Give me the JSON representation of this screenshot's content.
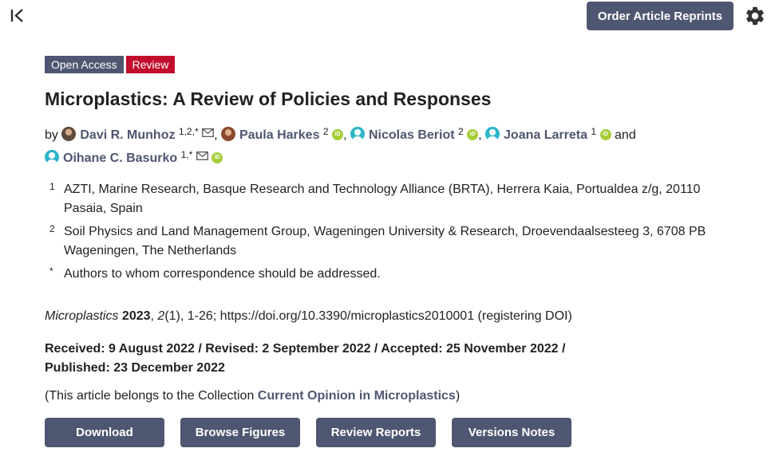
{
  "header": {
    "reprints_label": "Order Article Reprints"
  },
  "icons": {
    "collapse": "collapse-left-icon",
    "settings": "gear-icon",
    "email": "envelope-icon",
    "orcid": "orcid-icon",
    "avatar": "user-avatar-icon"
  },
  "badges": {
    "open_access": "Open Access",
    "type": "Review"
  },
  "article": {
    "title": "Microplastics: A Review of Policies and Responses",
    "by_label": "by",
    "and_label": "and",
    "authors": [
      {
        "name": "Davi R. Munhoz",
        "sup": "1,2,*"
      },
      {
        "name": "Paula Harkes",
        "sup": "2"
      },
      {
        "name": "Nicolas Beriot",
        "sup": "2"
      },
      {
        "name": "Joana Larreta",
        "sup": "1"
      },
      {
        "name": "Oihane C. Basurko",
        "sup": "1,*"
      }
    ],
    "affiliations": [
      {
        "marker": "1",
        "text": "AZTI, Marine Research, Basque Research and Technology Alliance (BRTA), Herrera Kaia, Portualdea z/g, 20110 Pasaia, Spain"
      },
      {
        "marker": "2",
        "text": "Soil Physics and Land Management Group, Wageningen University & Research, Droevendaalsesteeg 3, 6708 PB Wageningen, The Netherlands"
      },
      {
        "marker": "*",
        "text": "Authors to whom correspondence should be addressed."
      }
    ],
    "citation": {
      "journal": "Microplastics",
      "year": "2023",
      "volume": "2",
      "issue_pages": "(1), 1-26; https://doi.org/10.3390/microplastics2010001 (registering DOI)"
    },
    "dates_line1": "Received: 9 August 2022 / Revised: 2 September 2022 / Accepted: 25 November 2022 /",
    "dates_line2": "Published: 23 December 2022",
    "collection_prefix": "(This article belongs to the Collection ",
    "collection_name": "Current Opinion in Microplastics",
    "collection_suffix": ")"
  },
  "actions": {
    "download": "Download",
    "browse_figures": "Browse Figures",
    "review_reports": "Review Reports",
    "versions_notes": "Versions Notes"
  },
  "colors": {
    "primary": "#4f5671",
    "review_badge": "#c20d2d",
    "orcid": "#a6ce39",
    "avatar": "#2cb5c9"
  }
}
